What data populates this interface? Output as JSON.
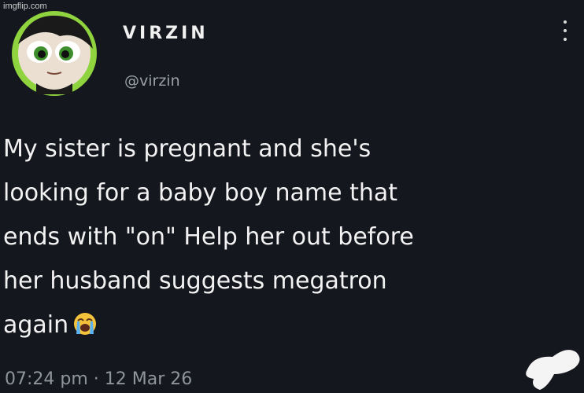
{
  "watermark": "imgflip.com",
  "user": {
    "display_name": "VIRZIN",
    "handle": "@virzin"
  },
  "tweet": {
    "lines": [
      "My sister is pregnant and she's",
      "looking for a baby boy name that",
      "ends with \"on\" Help her out before",
      "her husband suggests megatron",
      "again"
    ],
    "emoji": "loudly-crying-face"
  },
  "meta": {
    "time": "07:24 pm",
    "separator": " · ",
    "date": "12 Mar 26"
  },
  "icons": {
    "menu": "more-vertical-icon"
  },
  "colors": {
    "background": "#15171e",
    "avatar_ring": "#8fd33f",
    "muted_text": "#8f939c"
  }
}
